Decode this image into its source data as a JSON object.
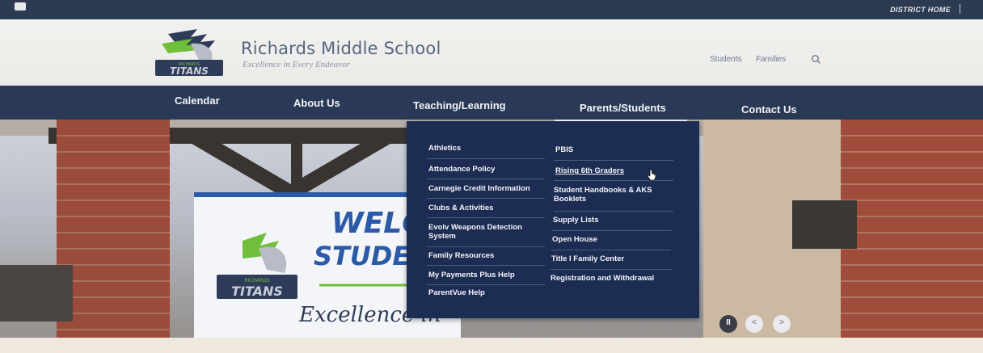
{
  "topbar": {
    "district_home": "DISTRICT HOME"
  },
  "header": {
    "school_name": "Richards Middle School",
    "tagline": "Excellence in Every Endeavor",
    "links": [
      "Students",
      "Families"
    ],
    "logo_text": "TITANS",
    "logo_sub": "RICHARDS"
  },
  "nav": {
    "items": [
      "Calendar",
      "About Us",
      "Teaching/Learning",
      "Parents/Students",
      "Contact Us"
    ]
  },
  "dropdown": {
    "left_column": [
      "Athletics",
      "Attendance Policy",
      "Carnegie Credit Information",
      "Clubs & Activities",
      "Evolv Weapons Detection System",
      "Family Resources",
      "My Payments Plus Help",
      "ParentVue Help"
    ],
    "right_column": [
      "PBIS",
      "Rising 6th Graders",
      "Student Handbooks & AKS Booklets",
      "Supply Lists",
      "Open House",
      "Title I Family Center",
      "Registration and Withdrawal"
    ]
  },
  "hero": {
    "banner_line1": "WELC",
    "banner_line2": "STUDEN",
    "banner_script": "Excellence in",
    "banner_logo_text": "TITANS",
    "banner_logo_sub": "RICHARDS"
  },
  "carousel": {
    "pause": "II",
    "prev": "<",
    "next": ">"
  },
  "colors": {
    "nav_bg": "#2a3956",
    "dropdown_bg": "#1d2c52",
    "accent_green": "#7ac143"
  }
}
